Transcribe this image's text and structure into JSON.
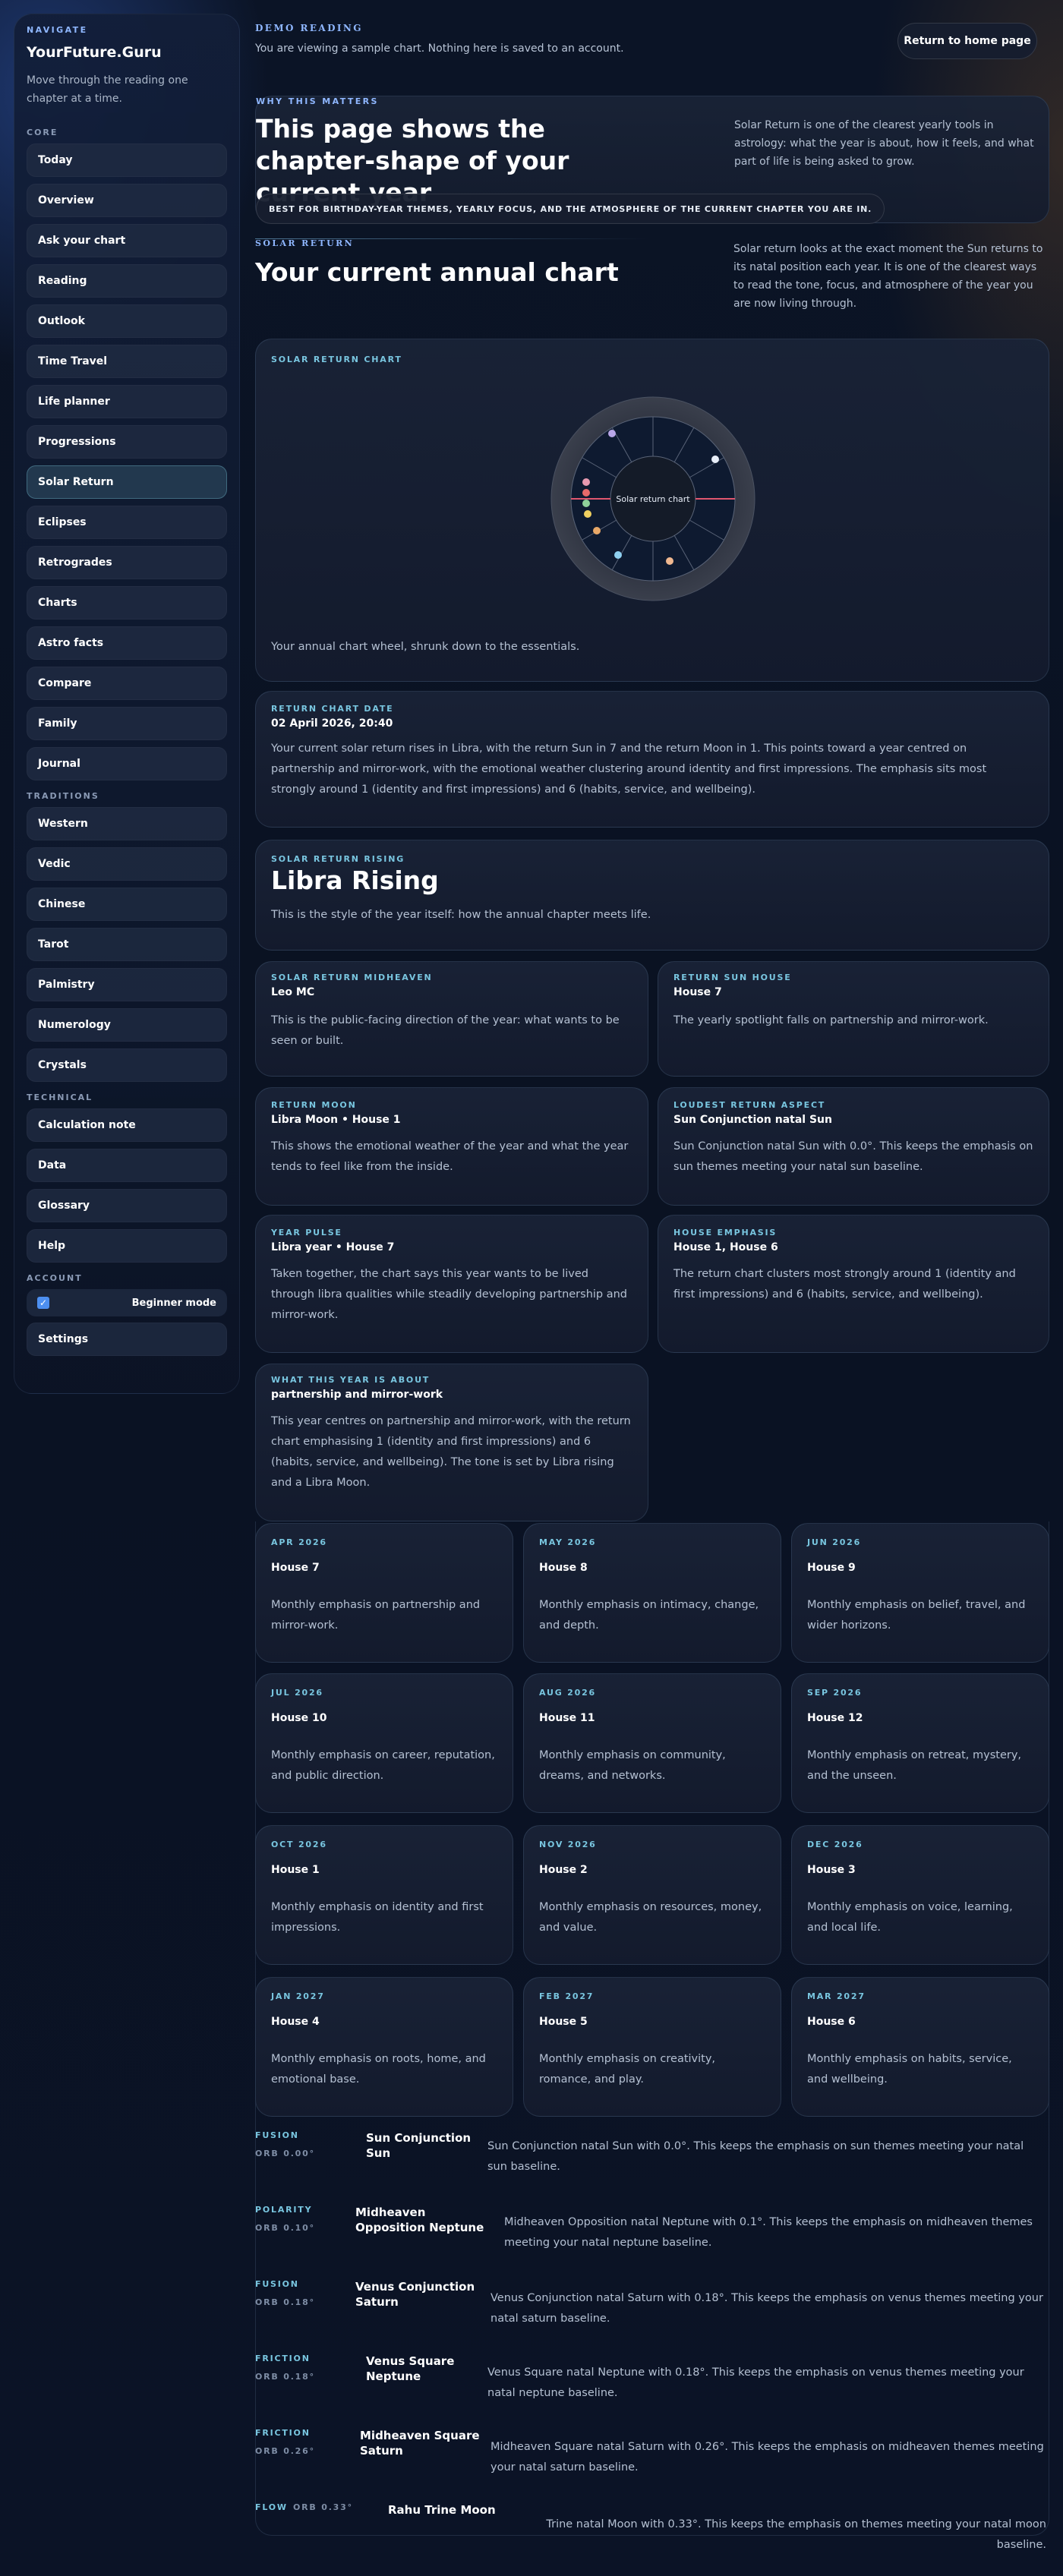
{
  "sidebar": {
    "eyebrow": "NAVIGATE",
    "brand": "YourFuture.Guru",
    "description": "Move through the reading one chapter at a time.",
    "groups": {
      "core": {
        "title": "CORE",
        "items": [
          "Today",
          "Overview",
          "Ask your chart",
          "Reading",
          "Outlook",
          "Time Travel",
          "Life planner",
          "Progressions",
          "Solar Return",
          "Eclipses",
          "Retrogrades",
          "Charts",
          "Astro facts",
          "Compare",
          "Family",
          "Journal"
        ]
      },
      "traditions": {
        "title": "TRADITIONS",
        "items": [
          "Western",
          "Vedic",
          "Chinese",
          "Tarot",
          "Palmistry",
          "Numerology",
          "Crystals"
        ]
      },
      "technical": {
        "title": "TECHNICAL",
        "items": [
          "Calculation note",
          "Data",
          "Glossary",
          "Help"
        ]
      },
      "account": {
        "title": "ACCOUNT",
        "beginner_label": "Beginner mode",
        "settings": "Settings"
      }
    }
  },
  "topbar": {
    "eyebrow": "DEMO READING",
    "text": "You are viewing a sample chart. Nothing here is saved to an account.",
    "home_button": "Return to home page"
  },
  "why": {
    "eyebrow": "WHY THIS MATTERS",
    "title": "This page shows the chapter-shape of your current year",
    "aside": "Solar Return is one of the clearest yearly tools in astrology: what the year is about, how it feels, and what part of life is being asked to grow.",
    "pill": "BEST FOR BIRTHDAY-YEAR THEMES, YEARLY FOCUS, AND THE ATMOSPHERE OF THE CURRENT CHAPTER YOU ARE IN."
  },
  "solar_return": {
    "eyebrow": "SOLAR RETURN",
    "title": "Your current annual chart",
    "aside": "Solar return looks at the exact moment the Sun returns to its natal position each year. It is one of the clearest ways to read the tone, focus, and atmosphere of the year you are now living through."
  },
  "chart_card": {
    "label": "SOLAR RETURN CHART",
    "center_label": "Solar return chart",
    "caption": "Your annual chart wheel, shrunk down to the essentials."
  },
  "date_card": {
    "label": "RETURN CHART DATE",
    "value": "02 April 2026, 20:40",
    "body": "Your current solar return rises in Libra, with the return Sun in 7 and the return Moon in 1. This points toward a year centred on partnership and mirror-work, with the emotional weather clustering around identity and first impressions. The emphasis sits most strongly around 1 (identity and first impressions) and 6 (habits, service, and wellbeing)."
  },
  "rising_card": {
    "label": "SOLAR RETURN RISING",
    "value": "Libra Rising",
    "body": "This is the style of the year itself: how the annual chapter meets life."
  },
  "grid": [
    {
      "label": "SOLAR RETURN MIDHEAVEN",
      "value": "Leo MC",
      "body": "This is the public-facing direction of the year: what wants to be seen or built."
    },
    {
      "label": "RETURN SUN HOUSE",
      "value": "House 7",
      "body": "The yearly spotlight falls on partnership and mirror-work."
    },
    {
      "label": "RETURN MOON",
      "value": "Libra Moon • House 1",
      "body": "This shows the emotional weather of the year and what the year tends to feel like from the inside."
    },
    {
      "label": "LOUDEST RETURN ASPECT",
      "value": "Sun Conjunction natal Sun",
      "body": "Sun Conjunction natal Sun with 0.0°. This keeps the emphasis on sun themes meeting your natal sun baseline."
    },
    {
      "label": "YEAR PULSE",
      "value": "Libra year • House 7",
      "body": "Taken together, the chart says this year wants to be lived through libra qualities while steadily developing partnership and mirror-work."
    },
    {
      "label": "HOUSE EMPHASIS",
      "value": "House 1, House 6",
      "body": "The return chart clusters most strongly around 1 (identity and first impressions) and 6 (habits, service, and wellbeing)."
    },
    {
      "label": "WHAT THIS YEAR IS ABOUT",
      "value": "partnership and mirror-work",
      "body": "This year centres on partnership and mirror-work, with the return chart emphasising 1 (identity and first impressions) and 6 (habits, service, and wellbeing). The tone is set by Libra rising and a Libra Moon."
    }
  ],
  "months": [
    {
      "month": "APR 2026",
      "house": "House 7",
      "body": "Monthly emphasis on partnership and mirror-work."
    },
    {
      "month": "MAY 2026",
      "house": "House 8",
      "body": "Monthly emphasis on intimacy, change, and depth."
    },
    {
      "month": "JUN 2026",
      "house": "House 9",
      "body": "Monthly emphasis on belief, travel, and wider horizons."
    },
    {
      "month": "JUL 2026",
      "house": "House 10",
      "body": "Monthly emphasis on career, reputation, and public direction."
    },
    {
      "month": "AUG 2026",
      "house": "House 11",
      "body": "Monthly emphasis on community, dreams, and networks."
    },
    {
      "month": "SEP 2026",
      "house": "House 12",
      "body": "Monthly emphasis on retreat, mystery, and the unseen."
    },
    {
      "month": "OCT 2026",
      "house": "House 1",
      "body": "Monthly emphasis on identity and first impressions."
    },
    {
      "month": "NOV 2026",
      "house": "House 2",
      "body": "Monthly emphasis on resources, money, and value."
    },
    {
      "month": "DEC 2026",
      "house": "House 3",
      "body": "Monthly emphasis on voice, learning, and local life."
    },
    {
      "month": "JAN 2027",
      "house": "House 4",
      "body": "Monthly emphasis on roots, home, and emotional base."
    },
    {
      "month": "FEB 2027",
      "house": "House 5",
      "body": "Monthly emphasis on creativity, romance, and play."
    },
    {
      "month": "MAR 2027",
      "house": "House 6",
      "body": "Monthly emphasis on habits, service, and wellbeing."
    }
  ],
  "aspects": [
    {
      "type": "FUSION",
      "orb": "ORB 0.00°",
      "name": "Sun Conjunction Sun",
      "desc": "Sun Conjunction natal Sun with 0.0°. This keeps the emphasis on sun themes meeting your natal sun baseline."
    },
    {
      "type": "POLARITY",
      "orb": "ORB 0.10°",
      "name": "Midheaven Opposition Neptune",
      "desc": "Midheaven Opposition natal Neptune with 0.1°. This keeps the emphasis on midheaven themes meeting your natal neptune baseline."
    },
    {
      "type": "FUSION",
      "orb": "ORB 0.18°",
      "name": "Venus Conjunction Saturn",
      "desc": "Venus Conjunction natal Saturn with 0.18°. This keeps the emphasis on venus themes meeting your natal saturn baseline."
    },
    {
      "type": "FRICTION",
      "orb": "ORB 0.18°",
      "name": "Venus Square Neptune",
      "desc": "Venus Square natal Neptune with 0.18°. This keeps the emphasis on venus themes meeting your natal neptune baseline."
    },
    {
      "type": "FRICTION",
      "orb": "ORB 0.26°",
      "name": "Midheaven Square Saturn",
      "desc": "Midheaven Square natal Saturn with 0.26°. This keeps the emphasis on midheaven themes meeting your natal saturn baseline."
    },
    {
      "type": "FLOW",
      "orb": "ORB 0.33°",
      "name": "Rahu Trine Moon",
      "desc": "Trine natal Moon with 0.33°. This keeps the emphasis on themes meeting your natal moon baseline."
    }
  ],
  "colors": {
    "accent": "#79c6e0",
    "eyebrow": "#8fb7ff",
    "planet_lavender": "#b9a6e8",
    "planet_white": "#e8eef8",
    "planet_pink": "#e79ab0",
    "planet_red": "#e76a6a",
    "planet_green": "#8fd19a",
    "planet_yellow": "#f0d060",
    "planet_orange": "#e8a868",
    "planet_blue": "#8fd0f0",
    "planet_peach": "#f0b890",
    "axis_line": "#e0566e"
  }
}
